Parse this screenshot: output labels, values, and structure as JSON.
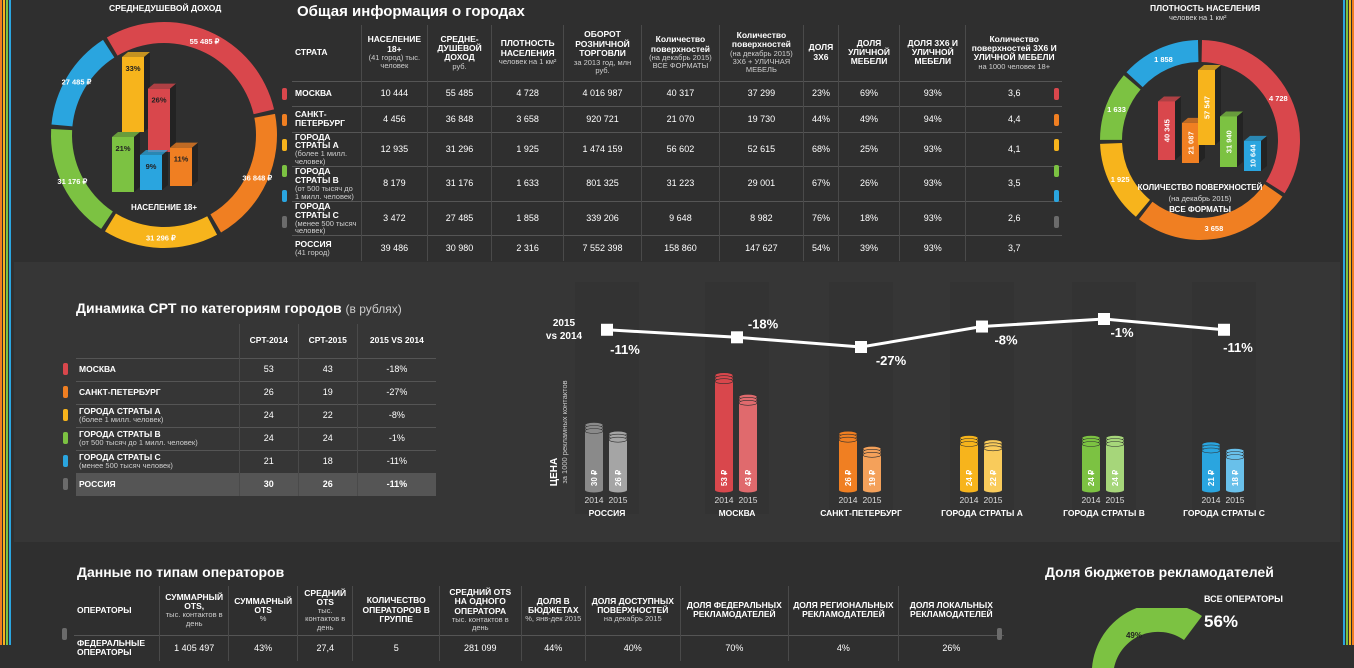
{
  "colors": {
    "moscow": "#d9474c",
    "spb": "#f07f22",
    "a": "#f7b41c",
    "b": "#7cc242",
    "c": "#2aa5df",
    "russia": "#6b6b6b"
  },
  "left_donut": {
    "title": "СРЕДНЕДУШЕВОЙ ДОХОД",
    "center_label": "НАСЕЛЕНИЕ 18+",
    "segments": [
      {
        "label": "55 485 ₽",
        "value": 55485,
        "color": "#d9474c"
      },
      {
        "label": "36 848 ₽",
        "value": 36848,
        "color": "#f07f22"
      },
      {
        "label": "31 296 ₽",
        "value": 31296,
        "color": "#f7b41c"
      },
      {
        "label": "31 176 ₽",
        "value": 31176,
        "color": "#7cc242"
      },
      {
        "label": "27 485 ₽",
        "value": 27485,
        "color": "#2aa5df"
      }
    ],
    "bars": [
      {
        "label": "33%",
        "value": 33,
        "color": "#f7b41c"
      },
      {
        "label": "26%",
        "value": 26,
        "color": "#d9474c"
      },
      {
        "label": "21%",
        "value": 21,
        "color": "#7cc242"
      },
      {
        "label": "9%",
        "value": 9,
        "color": "#2aa5df"
      },
      {
        "label": "11%",
        "value": 11,
        "color": "#f07f22"
      }
    ]
  },
  "right_donut": {
    "title": "ПЛОТНОСТЬ НАСЕЛЕНИЯ",
    "subtitle": "человек на 1 км²",
    "center_label": "КОЛИЧЕСТВО ПОВЕРХНОСТЕЙ",
    "center_sub1": "(на декабрь 2015)",
    "center_sub2": "ВСЕ ФОРМАТЫ",
    "segments": [
      {
        "label": "4 728",
        "value": 4728,
        "color": "#d9474c"
      },
      {
        "label": "3 658",
        "value": 3658,
        "color": "#f07f22"
      },
      {
        "label": "1 925",
        "value": 1925,
        "color": "#f7b41c"
      },
      {
        "label": "1 633",
        "value": 1633,
        "color": "#7cc242"
      },
      {
        "label": "1 858",
        "value": 1858,
        "color": "#2aa5df"
      }
    ],
    "bars": [
      {
        "label": "40 345",
        "value": 40345,
        "color": "#d9474c"
      },
      {
        "label": "21 087",
        "value": 21087,
        "color": "#f07f22"
      },
      {
        "label": "57 547",
        "value": 57547,
        "color": "#f7b41c"
      },
      {
        "label": "31 940",
        "value": 31940,
        "color": "#7cc242"
      },
      {
        "label": "10 644",
        "value": 10644,
        "color": "#2aa5df"
      }
    ]
  },
  "cities": {
    "title": "Общая информация о городах",
    "headers": [
      {
        "main": "СТРАТА",
        "sub": ""
      },
      {
        "main": "НАСЕЛЕНИЕ 18+",
        "sub": "(41 город) тыс. человек"
      },
      {
        "main": "СРЕДНЕ-ДУШЕВОЙ ДОХОД",
        "sub": "руб."
      },
      {
        "main": "ПЛОТНОСТЬ НАСЕЛЕНИЯ",
        "sub": "человек на 1 км²"
      },
      {
        "main": "ОБОРОТ РОЗНИЧНОЙ ТОРГОВЛИ",
        "sub": "за 2013 год, млн руб."
      },
      {
        "main": "Количество поверхностей",
        "sub": "(на декабрь 2015) ВСЕ ФОРМАТЫ"
      },
      {
        "main": "Количество поверхностей",
        "sub": "(на декабрь 2015) 3Х6 + УЛИЧНАЯ МЕБЕЛЬ"
      },
      {
        "main": "ДОЛЯ 3Х6",
        "sub": ""
      },
      {
        "main": "ДОЛЯ УЛИЧНОЙ МЕБЕЛИ",
        "sub": ""
      },
      {
        "main": "ДОЛЯ 3Х6 И УЛИЧНОЙ МЕБЕЛИ",
        "sub": ""
      },
      {
        "main": "Количество поверхностей 3Х6 И УЛИЧНОЙ МЕБЕЛИ",
        "sub": "на 1000 человек 18+"
      }
    ],
    "rows": [
      {
        "name": "МОСКВА",
        "sub": "",
        "color": "#d9474c",
        "cells": [
          "10 444",
          "55 485",
          "4 728",
          "4 016 987",
          "40 317",
          "37 299",
          "23%",
          "69%",
          "93%",
          "3,6"
        ]
      },
      {
        "name": "САНКТ-ПЕТЕРБУРГ",
        "sub": "",
        "color": "#f07f22",
        "cells": [
          "4 456",
          "36 848",
          "3 658",
          "920 721",
          "21 070",
          "19 730",
          "44%",
          "49%",
          "94%",
          "4,4"
        ]
      },
      {
        "name": "ГОРОДА СТРАТЫ А",
        "sub": "(более 1 милл. человек)",
        "color": "#f7b41c",
        "cells": [
          "12 935",
          "31 296",
          "1 925",
          "1 474 159",
          "56 602",
          "52 615",
          "68%",
          "25%",
          "93%",
          "4,1"
        ]
      },
      {
        "name": "ГОРОДА СТРАТЫ В",
        "sub": "(от 500 тысяч до 1 милл. человек)",
        "color": "#7cc242",
        "cells": [
          "8 179",
          "31 176",
          "1 633",
          "801 325",
          "31 223",
          "29 001",
          "67%",
          "26%",
          "93%",
          "3,5"
        ]
      },
      {
        "name": "ГОРОДА СТРАТЫ С",
        "sub": "(менее 500 тысяч человек)",
        "color": "#2aa5df",
        "cells": [
          "3 472",
          "27 485",
          "1 858",
          "339 206",
          "9 648",
          "8 982",
          "76%",
          "18%",
          "93%",
          "2,6"
        ]
      },
      {
        "name": "РОССИЯ",
        "sub": "(41 город)",
        "color": "#6b6b6b",
        "cells": [
          "39 486",
          "30 980",
          "2 316",
          "7 552 398",
          "158 860",
          "147 627",
          "54%",
          "39%",
          "93%",
          "3,7"
        ]
      }
    ]
  },
  "cpt": {
    "title": "Динамика CPT по категориям городов",
    "title_suffix": "(в рублях)",
    "headers": [
      "",
      "CPT-2014",
      "CPT-2015",
      "2015 VS 2014"
    ],
    "rows": [
      {
        "name": "МОСКВА",
        "sub": "",
        "color": "#d9474c",
        "cells": [
          "53",
          "43",
          "-18%"
        ]
      },
      {
        "name": "САНКТ-ПЕТЕРБУРГ",
        "sub": "",
        "color": "#f07f22",
        "cells": [
          "26",
          "19",
          "-27%"
        ]
      },
      {
        "name": "ГОРОДА СТРАТЫ А",
        "sub": "(более 1 милл. человек)",
        "color": "#f7b41c",
        "cells": [
          "24",
          "22",
          "-8%"
        ]
      },
      {
        "name": "ГОРОДА СТРАТЫ В",
        "sub": "(от 500 тысяч до 1 милл. человек)",
        "color": "#7cc242",
        "cells": [
          "24",
          "24",
          "-1%"
        ]
      },
      {
        "name": "ГОРОДА СТРАТЫ С",
        "sub": "(менее 500 тысяч человек)",
        "color": "#2aa5df",
        "cells": [
          "21",
          "18",
          "-11%"
        ]
      },
      {
        "name": "РОССИЯ",
        "sub": "",
        "color": "#6b6b6b",
        "cells": [
          "30",
          "26",
          "-11%"
        ]
      }
    ]
  },
  "chart_data": {
    "type": "bar",
    "line_label_1": "2015",
    "line_label_2": "vs 2014",
    "y_label": "ЦЕНА",
    "y_sublabel": "за 1000 рекламных контактов",
    "categories": [
      "РОССИЯ",
      "МОСКВА",
      "САНКТ-ПЕТЕРБУРГ",
      "ГОРОДА СТРАТЫ А",
      "ГОРОДА СТРАТЫ В",
      "ГОРОДА СТРАТЫ С"
    ],
    "years": [
      "2014",
      "2015"
    ],
    "series": [
      {
        "name": "2014",
        "values": [
          30,
          53,
          26,
          24,
          24,
          21
        ],
        "labels": [
          "30 ₽",
          "53 ₽",
          "26 ₽",
          "24 ₽",
          "24 ₽",
          "21 ₽"
        ]
      },
      {
        "name": "2015",
        "values": [
          26,
          43,
          19,
          22,
          24,
          18
        ],
        "labels": [
          "26 ₽",
          "43 ₽",
          "19 ₽",
          "22 ₽",
          "24 ₽",
          "18 ₽"
        ]
      }
    ],
    "change": [
      -11,
      -18,
      -27,
      -8,
      -1,
      -11
    ],
    "change_labels": [
      "-11%",
      "-18%",
      "-27%",
      "-8%",
      "-1%",
      "-11%"
    ],
    "colors_2014": [
      "#8a8a8a",
      "#d9474c",
      "#f07f22",
      "#f7b41c",
      "#7cc242",
      "#2aa5df"
    ],
    "colors_2015": [
      "#a5a5a5",
      "#e06a6d",
      "#f4a15a",
      "#f9cb5b",
      "#a6d67a",
      "#69c0ea"
    ]
  },
  "operators": {
    "title": "Данные по типам операторов",
    "headers": [
      {
        "main": "ОПЕРАТОРЫ",
        "sub": ""
      },
      {
        "main": "СУММАРНЫЙ OTS,",
        "sub": "тыс. контактов в день"
      },
      {
        "main": "СУММАРНЫЙ OTS",
        "sub": "%"
      },
      {
        "main": "СРЕДНИЙ OTS",
        "sub": "тыс. контактов в день"
      },
      {
        "main": "КОЛИЧЕСТВО ОПЕРАТОРОВ В ГРУППЕ",
        "sub": ""
      },
      {
        "main": "СРЕДНИЙ OTS НА ОДНОГО ОПЕРАТОРА",
        "sub": "тыс. контактов в день"
      },
      {
        "main": "ДОЛЯ В БЮДЖЕТАХ",
        "sub": "%, янв-дек 2015"
      },
      {
        "main": "ДОЛЯ ДОСТУПНЫХ ПОВЕРХНОСТЕЙ",
        "sub": "на декабрь 2015"
      },
      {
        "main": "ДОЛЯ ФЕДЕРАЛЬНЫХ РЕКЛАМОДАТЕЛЕЙ",
        "sub": ""
      },
      {
        "main": "ДОЛЯ РЕГИОНАЛЬНЫХ РЕКЛАМОДАТЕЛЕЙ",
        "sub": ""
      },
      {
        "main": "ДОЛЯ ЛОКАЛЬНЫХ РЕКЛАМОДАТЕЛЕЙ",
        "sub": ""
      }
    ],
    "rows": [
      {
        "name": "ФЕДЕРАЛЬНЫЕ ОПЕРАТОРЫ",
        "cells": [
          "1 405 497",
          "43%",
          "27,4",
          "5",
          "281 099",
          "44%",
          "40%",
          "70%",
          "4%",
          "26%"
        ]
      }
    ]
  },
  "budget": {
    "title": "Доля бюджетов рекламодателей",
    "all_label": "ВСЕ ОПЕРАТОРЫ",
    "all_value": "56%",
    "arc_label": "49%",
    "arc_value": 49
  }
}
